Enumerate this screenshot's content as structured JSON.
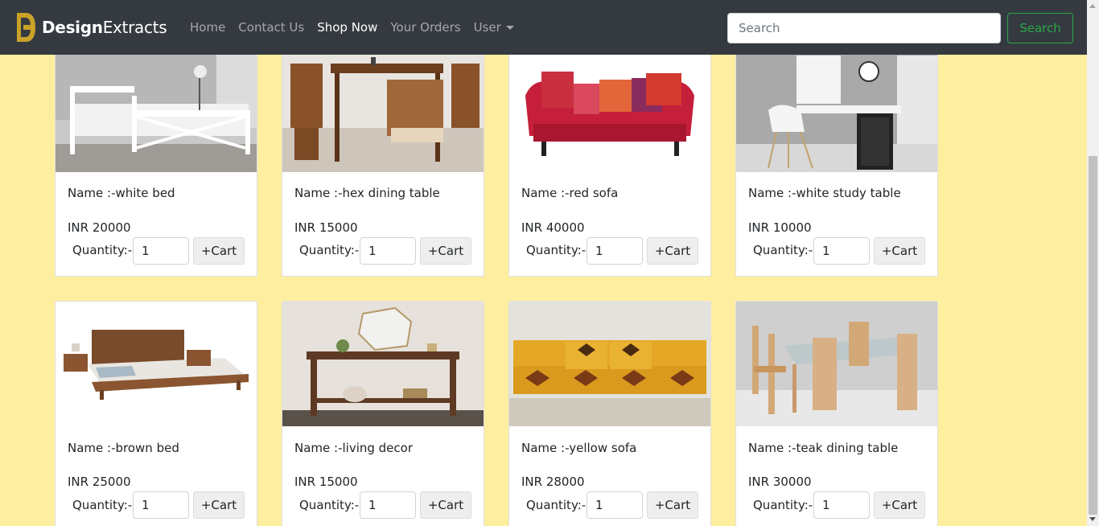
{
  "brand": {
    "name_bold": "Design",
    "name_rest": "Extracts",
    "accent": "#c9a227"
  },
  "nav": {
    "home": "Home",
    "contact": "Contact Us",
    "shop": "Shop Now",
    "orders": "Your Orders",
    "user": "User"
  },
  "search": {
    "placeholder": "Search",
    "button": "Search"
  },
  "labels": {
    "quantity": "Quantity:-",
    "cart": "+Cart"
  },
  "products": [
    {
      "name": "Name :-white bed",
      "price": "INR 20000",
      "qty": "1",
      "image": "white-bed-image"
    },
    {
      "name": "Name :-hex dining table",
      "price": "INR 15000",
      "qty": "1",
      "image": "dining-table-image"
    },
    {
      "name": "Name :-red sofa",
      "price": "INR 40000",
      "qty": "1",
      "image": "red-sofa-image"
    },
    {
      "name": "Name :-white study table",
      "price": "INR 10000",
      "qty": "1",
      "image": "study-table-image"
    },
    {
      "name": "Name :-brown bed",
      "price": "INR 25000",
      "qty": "1",
      "image": "brown-bed-image"
    },
    {
      "name": "Name :-living decor",
      "price": "INR 15000",
      "qty": "1",
      "image": "living-decor-image"
    },
    {
      "name": "Name :-yellow sofa",
      "price": "INR 28000",
      "qty": "1",
      "image": "yellow-sofa-image"
    },
    {
      "name": "Name :-teak dining table",
      "price": "INR 30000",
      "qty": "1",
      "image": "teak-dining-image"
    }
  ],
  "colors": {
    "navbar": "#343a40",
    "page_bg": "#feeea0",
    "search_green": "#28a745"
  }
}
